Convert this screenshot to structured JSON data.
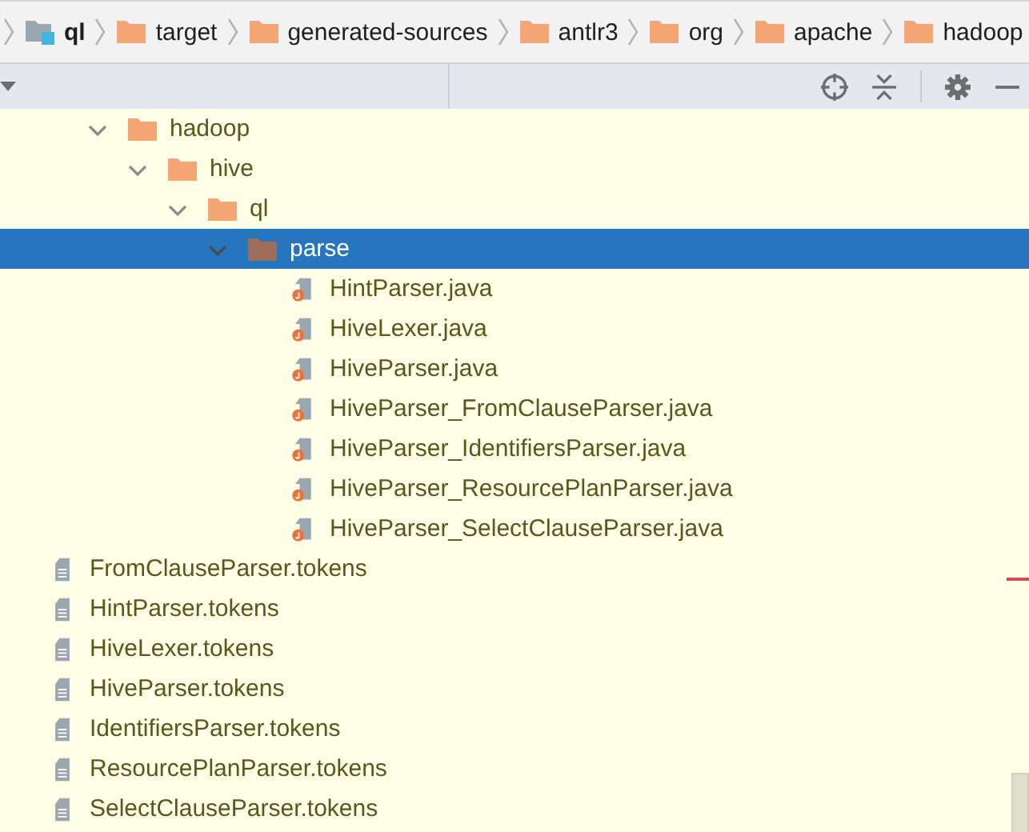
{
  "breadcrumb": [
    {
      "label": "ql",
      "kind": "module"
    },
    {
      "label": "target",
      "kind": "folder"
    },
    {
      "label": "generated-sources",
      "kind": "folder"
    },
    {
      "label": "antlr3",
      "kind": "folder"
    },
    {
      "label": "org",
      "kind": "folder"
    },
    {
      "label": "apache",
      "kind": "folder"
    },
    {
      "label": "hadoop",
      "kind": "folder"
    }
  ],
  "tree": {
    "scrolled_branch": {
      "name": "hadoop",
      "kind": "folder",
      "expanded": true,
      "selected": false,
      "children": [
        {
          "name": "hive",
          "kind": "folder",
          "expanded": true,
          "selected": false,
          "children": [
            {
              "name": "ql",
              "kind": "folder",
              "expanded": true,
              "selected": false,
              "children": [
                {
                  "name": "parse",
                  "kind": "folder",
                  "expanded": true,
                  "selected": true,
                  "children": [
                    {
                      "name": "HintParser.java",
                      "kind": "java",
                      "selected": false
                    },
                    {
                      "name": "HiveLexer.java",
                      "kind": "java",
                      "selected": false
                    },
                    {
                      "name": "HiveParser.java",
                      "kind": "java",
                      "selected": false
                    },
                    {
                      "name": "HiveParser_FromClauseParser.java",
                      "kind": "java",
                      "selected": false
                    },
                    {
                      "name": "HiveParser_IdentifiersParser.java",
                      "kind": "java",
                      "selected": false
                    },
                    {
                      "name": "HiveParser_ResourcePlanParser.java",
                      "kind": "java",
                      "selected": false
                    },
                    {
                      "name": "HiveParser_SelectClauseParser.java",
                      "kind": "java",
                      "selected": false
                    }
                  ]
                }
              ]
            }
          ]
        }
      ]
    },
    "items": [
      {
        "name": "FromClauseParser.tokens",
        "kind": "tokens",
        "selected": false
      },
      {
        "name": "HintParser.tokens",
        "kind": "tokens",
        "selected": false
      },
      {
        "name": "HiveLexer.tokens",
        "kind": "tokens",
        "selected": false
      },
      {
        "name": "HiveParser.tokens",
        "kind": "tokens",
        "selected": false
      },
      {
        "name": "IdentifiersParser.tokens",
        "kind": "tokens",
        "selected": false
      },
      {
        "name": "ResourcePlanParser.tokens",
        "kind": "tokens",
        "selected": false
      },
      {
        "name": "SelectClauseParser.tokens",
        "kind": "tokens",
        "selected": false
      }
    ]
  }
}
